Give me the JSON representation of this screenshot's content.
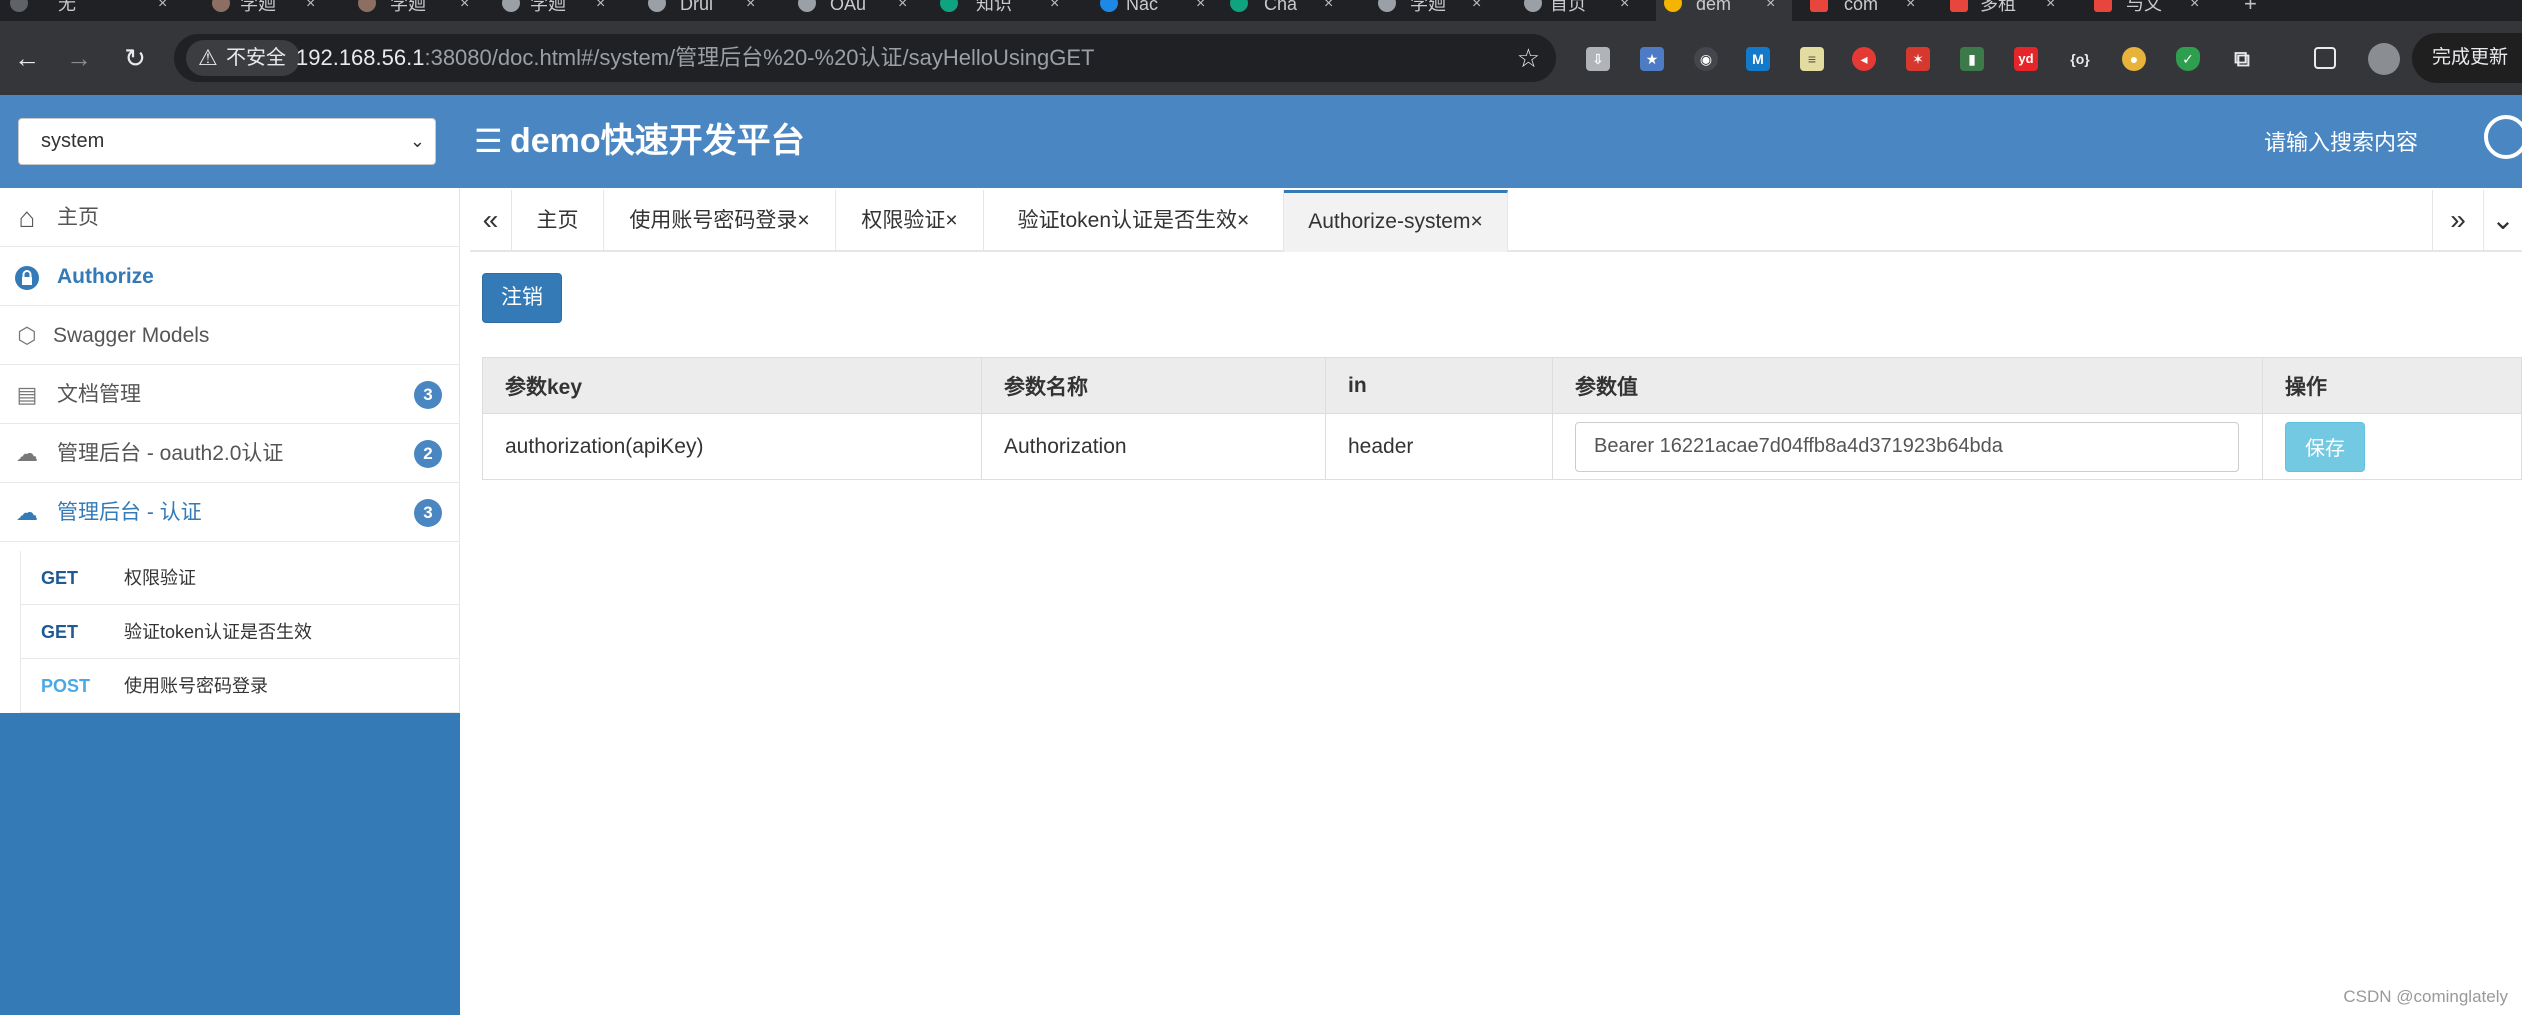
{
  "browser": {
    "tabs": [
      {
        "title": "无",
        "icon_color": "#5f6368"
      },
      {
        "title": "学廻",
        "icon_color": "#8d6e63"
      },
      {
        "title": "学廻",
        "icon_color": "#8d6e63"
      },
      {
        "title": "学廻",
        "icon_color": "#9aa0a6"
      },
      {
        "title": "Drui",
        "icon_color": "#9aa0a6"
      },
      {
        "title": "OAu",
        "icon_color": "#9aa0a6"
      },
      {
        "title": "知识",
        "icon_color": "#10a37f"
      },
      {
        "title": "Nac",
        "icon_color": "#1e88e5"
      },
      {
        "title": "Cha",
        "icon_color": "#10a37f"
      },
      {
        "title": "学廻",
        "icon_color": "#9aa0a6"
      },
      {
        "title": "首页",
        "icon_color": "#9aa0a6"
      },
      {
        "title": "dem",
        "icon_color": "#f4b400"
      },
      {
        "title": "com",
        "icon_color": "#e8453c"
      },
      {
        "title": "多租",
        "icon_color": "#e8453c"
      },
      {
        "title": "与文",
        "icon_color": "#e8453c"
      }
    ],
    "close_glyph": "×",
    "new_tab_glyph": "+",
    "back": "←",
    "forward": "→",
    "reload": "↻",
    "security_label": "不安全",
    "url_host": "192.168.56.1",
    "url_rest": ":38080/doc.html#/system/管理后台%20-%20认证/sayHelloUsingGET",
    "update_label": "完成更新",
    "extensions": [
      "download-ext-icon",
      "bookmark-ext-icon",
      "dark-ext-icon",
      "m-ext-icon",
      "note-ext-icon",
      "record-ext-icon",
      "santa-ext-icon",
      "bottle-ext-icon",
      "yd-ext-icon",
      "braces-ext-icon",
      "chrome-ext-icon",
      "shield-ext-icon",
      "puzzle-ext-icon",
      "sidepanel-icon",
      "profile-avatar"
    ]
  },
  "header": {
    "system_select": "system",
    "app_title": "demo快速开发平台",
    "search_placeholder": "请输入搜索内容"
  },
  "sidebar": {
    "items": [
      {
        "label": "主页",
        "icon": "home-icon",
        "glyph": "⌂"
      },
      {
        "label": "Authorize",
        "icon": "lock-icon",
        "glyph": "🔒"
      },
      {
        "label": "Swagger Models",
        "icon": "cube-icon",
        "glyph": "⬡"
      },
      {
        "label": "文档管理",
        "icon": "doc-settings-icon",
        "glyph": "▤",
        "badge": "3"
      },
      {
        "label": "管理后台 - oauth2.0认证",
        "icon": "cloud-icon",
        "glyph": "☁",
        "badge": "2"
      },
      {
        "label": "管理后台 - 认证",
        "icon": "cloud-icon",
        "glyph": "☁",
        "badge": "3"
      }
    ],
    "apis": [
      {
        "method": "GET",
        "title": "权限验证"
      },
      {
        "method": "GET",
        "title": "验证token认证是否生效"
      },
      {
        "method": "POST",
        "title": "使用账号密码登录"
      }
    ]
  },
  "content_tabs": {
    "prev": "«",
    "next": "»",
    "more": "⌄",
    "items": [
      {
        "label": "主页"
      },
      {
        "label": "使用账号密码登录×"
      },
      {
        "label": "权限验证×"
      },
      {
        "label": "验证token认证是否生效×"
      },
      {
        "label": "Authorize-system×"
      }
    ]
  },
  "auth": {
    "logout_label": "注销",
    "columns": [
      "参数key",
      "参数名称",
      "in",
      "参数值",
      "操作"
    ],
    "row": {
      "key": "authorization(apiKey)",
      "name": "Authorization",
      "in": "header",
      "value": "Bearer 16221acae7d04ffb8a4d371923b64bda",
      "save_label": "保存"
    }
  },
  "watermark": "CSDN @cominglately",
  "colors": {
    "header_bg": "#4a86c1",
    "sidebar_bg": "#337ab7",
    "primary": "#337ab7",
    "info": "#5bc0de",
    "chrome_dark": "#202124",
    "chrome_toolbar": "#35363a"
  }
}
